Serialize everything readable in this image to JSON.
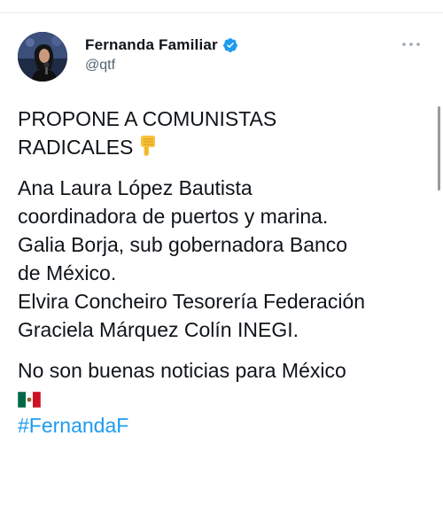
{
  "author": {
    "display_name": "Fernanda Familiar",
    "handle": "@qtf"
  },
  "tweet": {
    "line_1": "PROPONE A COMUNISTAS",
    "line_2": "RADICALES",
    "line_3": "Ana Laura López Bautista",
    "line_4": "coordinadora de puertos y marina.",
    "line_5": "Galia Borja, sub gobernadora Banco",
    "line_6": "de México.",
    "line_7": "Elvira Concheiro Tesorería Federación",
    "line_8": "Graciela Márquez Colín INEGI.",
    "line_9": "No son buenas noticias para México",
    "hashtag": "#FernandaF"
  },
  "icons": {
    "verified": "verified-badge-icon",
    "more": "more-options-icon",
    "pointing": "pointing-down-emoji-icon",
    "flag": "mexico-flag-emoji-icon"
  },
  "colors": {
    "accent": "#1d9bf0",
    "secondary_text": "#536471",
    "primary_text": "#0f1419"
  }
}
